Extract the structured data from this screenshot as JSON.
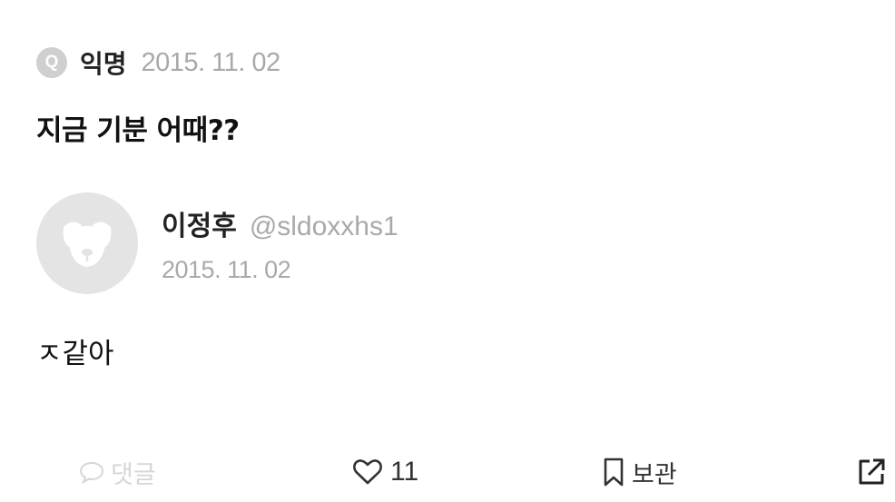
{
  "question": {
    "badge": "Q",
    "asker": "익명",
    "date": "2015. 11. 02",
    "text": "지금 기분 어때??"
  },
  "answer": {
    "name": "이정후",
    "handle": "@sldoxxhs1",
    "date": "2015. 11. 02",
    "text": "ㅈ같아"
  },
  "actions": {
    "comment_label": "댓글",
    "like_count": "11",
    "save_label": "보관"
  },
  "icons": {
    "comment": "comment-bubble-icon",
    "like": "heart-icon",
    "save": "bookmark-icon",
    "share": "share-external-icon",
    "avatar": "default-dog-avatar-icon"
  },
  "colors": {
    "muted_text": "#a9a9a9",
    "badge_bg": "#cfcfcf",
    "avatar_bg": "#e4e4e4",
    "disabled": "#d6d6d6"
  }
}
